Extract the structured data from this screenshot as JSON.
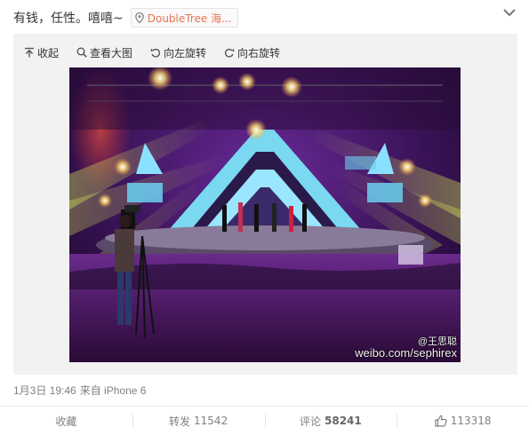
{
  "post": {
    "text": "有钱，任性。嘻嘻~",
    "location": "DoubleTree 海..."
  },
  "toolbar": {
    "collapse": "收起",
    "view_large": "查看大图",
    "rotate_left": "向左旋转",
    "rotate_right": "向右旋转"
  },
  "photo": {
    "watermark_user": "@王思聪",
    "watermark_url": "weibo.com/sephirex"
  },
  "meta": {
    "date": "1月3日 19:46",
    "source": "来自 iPhone 6"
  },
  "actions": {
    "favorite_label": "收藏",
    "repost_label": "转发",
    "repost_count": "11542",
    "comment_label": "评论",
    "comment_count": "58241",
    "like_count": "113318"
  },
  "colors": {
    "location_text": "#eb7350",
    "meta_text": "#808080",
    "panel_bg": "#f2f2f2"
  }
}
